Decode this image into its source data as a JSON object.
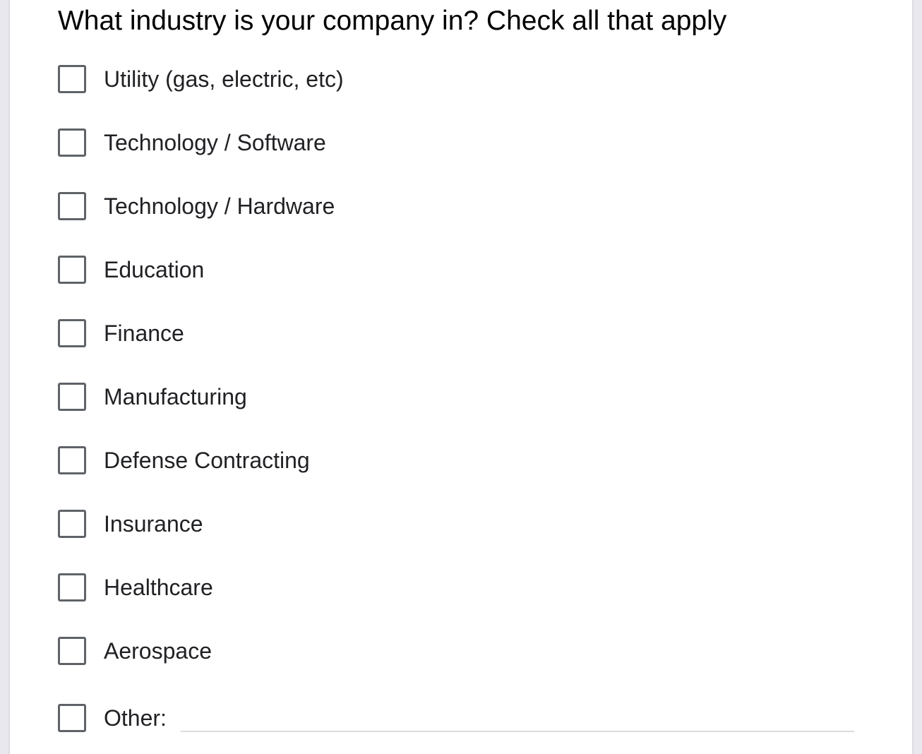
{
  "form": {
    "question": "What industry is your company in? Check all that apply",
    "options": [
      {
        "label": "Utility (gas, electric, etc)",
        "checked": false
      },
      {
        "label": "Technology / Software",
        "checked": false
      },
      {
        "label": "Technology / Hardware",
        "checked": false
      },
      {
        "label": "Education",
        "checked": false
      },
      {
        "label": "Finance",
        "checked": false
      },
      {
        "label": "Manufacturing",
        "checked": false
      },
      {
        "label": "Defense Contracting",
        "checked": false
      },
      {
        "label": "Insurance",
        "checked": false
      },
      {
        "label": "Healthcare",
        "checked": false
      },
      {
        "label": "Aerospace",
        "checked": false
      },
      {
        "label": "Other:",
        "checked": false
      }
    ],
    "other_value": ""
  }
}
